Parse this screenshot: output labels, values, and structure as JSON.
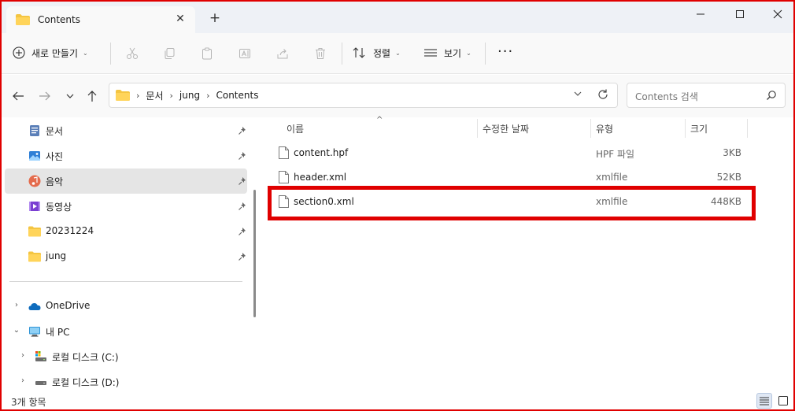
{
  "window": {
    "tab_title": "Contents",
    "new_tab": "+",
    "close_tab": "✕"
  },
  "toolbar": {
    "new_label": "새로 만들기",
    "sort_label": "정렬",
    "view_label": "보기",
    "more_label": "···",
    "chevron": "⌄"
  },
  "address": {
    "breadcrumbs": [
      "문서",
      "jung",
      "Contents"
    ],
    "separator": "›",
    "search_placeholder": "Contents 검색"
  },
  "sidebar": {
    "quick_access": [
      {
        "label": "문서",
        "icon": "document-icon",
        "pinned": true
      },
      {
        "label": "사진",
        "icon": "pictures-icon",
        "pinned": true
      },
      {
        "label": "음악",
        "icon": "music-icon",
        "pinned": true,
        "selected": true
      },
      {
        "label": "동영상",
        "icon": "video-icon",
        "pinned": true
      },
      {
        "label": "20231224",
        "icon": "folder-icon",
        "pinned": true
      },
      {
        "label": "jung",
        "icon": "folder-icon",
        "pinned": true
      }
    ],
    "tree": [
      {
        "label": "OneDrive",
        "icon": "cloud-icon",
        "expander": "›"
      },
      {
        "label": "내 PC",
        "icon": "pc-icon",
        "expander": "⌄"
      },
      {
        "label": "로컬 디스크 (C:)",
        "icon": "drive-icon",
        "expander": "›"
      },
      {
        "label": "로컬 디스크 (D:)",
        "icon": "drive-icon",
        "expander": "›"
      }
    ]
  },
  "columns": {
    "name": "이름",
    "modified": "수정한 날짜",
    "type": "유형",
    "size": "크기",
    "sort_indicator": "^"
  },
  "files": [
    {
      "name": "content.hpf",
      "type": "HPF 파일",
      "size": "3KB"
    },
    {
      "name": "header.xml",
      "type": "xmlfile",
      "size": "52KB"
    },
    {
      "name": "section0.xml",
      "type": "xmlfile",
      "size": "448KB"
    }
  ],
  "status": {
    "item_count": "3개 항목"
  },
  "colors": {
    "accent": "#e00000",
    "folder": "#f4c542",
    "selected_bg": "#e5e5e5"
  }
}
